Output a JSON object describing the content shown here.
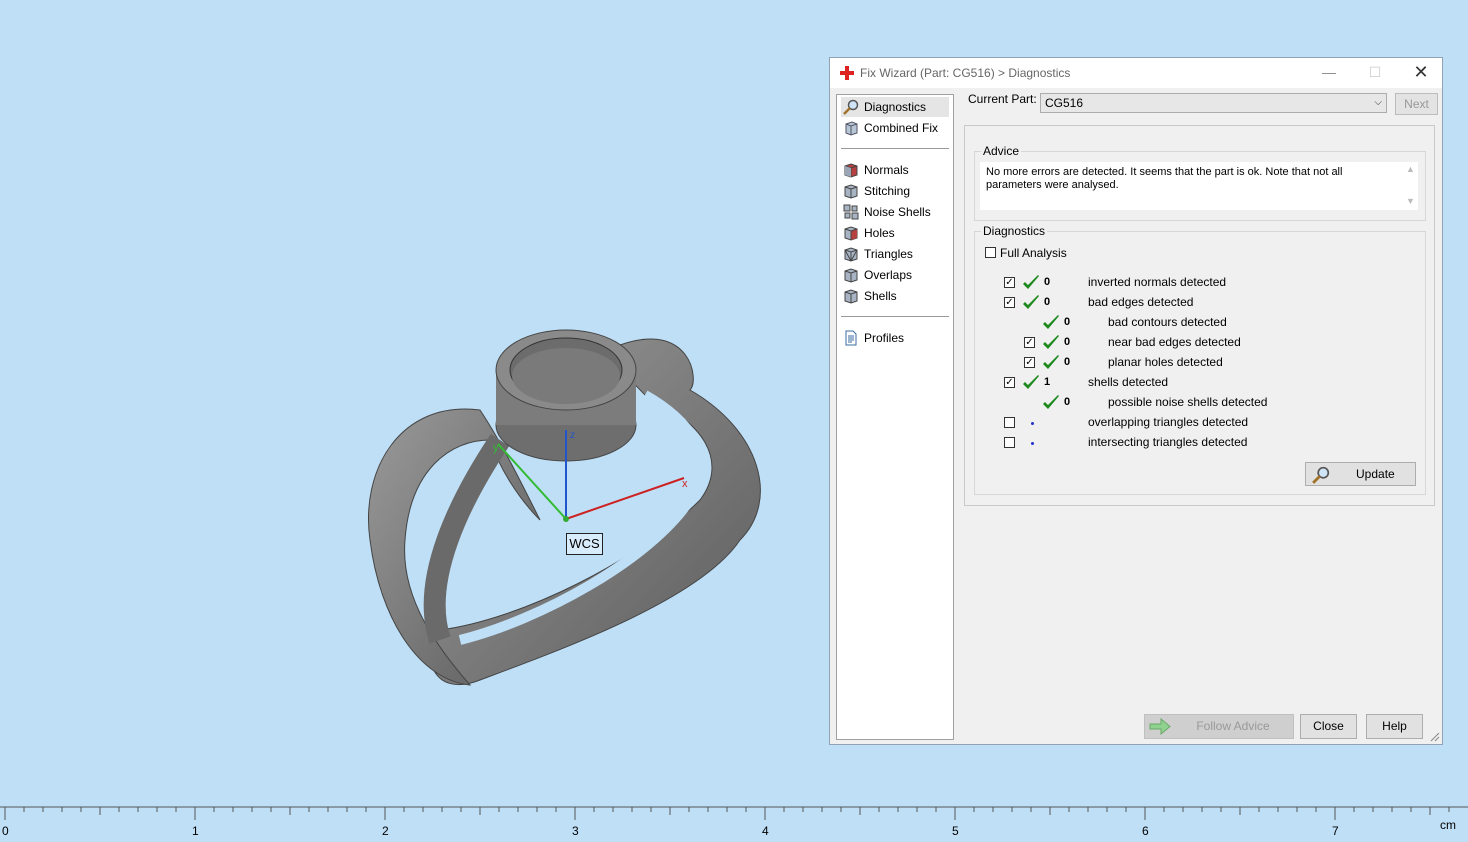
{
  "viewport": {
    "wcs_label": "WCS",
    "axes": {
      "x": "x",
      "y": "y",
      "z": "z"
    },
    "colors": {
      "background": "#bfdff6",
      "model": "#7a7a7a",
      "axis_x": "#cc2222",
      "axis_y": "#33bb33",
      "axis_z": "#2255cc"
    }
  },
  "ruler": {
    "labels": [
      "0",
      "1",
      "2",
      "3",
      "4",
      "5",
      "6",
      "7"
    ],
    "unit": "cm"
  },
  "dialog": {
    "title": "Fix Wizard (Part: CG516) > Diagnostics",
    "window_buttons": {
      "minimize": "—",
      "maximize": "☐",
      "close": "✕"
    },
    "sidebar": {
      "group1": [
        {
          "label": "Diagnostics",
          "icon": "magnifier-icon",
          "selected": true
        },
        {
          "label": "Combined Fix",
          "icon": "cube-icon"
        }
      ],
      "group2": [
        {
          "label": "Normals",
          "icon": "normals-cube-icon"
        },
        {
          "label": "Stitching",
          "icon": "stitching-cube-icon"
        },
        {
          "label": "Noise Shells",
          "icon": "noise-shells-icon"
        },
        {
          "label": "Holes",
          "icon": "holes-cube-icon"
        },
        {
          "label": "Triangles",
          "icon": "triangles-cube-icon"
        },
        {
          "label": "Overlaps",
          "icon": "overlaps-cube-icon"
        },
        {
          "label": "Shells",
          "icon": "shells-cube-icon"
        }
      ],
      "group3": [
        {
          "label": "Profiles",
          "icon": "document-icon"
        }
      ]
    },
    "current_part_label": "Current Part:",
    "current_part_value": "CG516",
    "next_label": "Next",
    "advice": {
      "title": "Advice",
      "text": "No more errors are detected. It seems that the part is ok. Note that not all parameters were analysed."
    },
    "diagnostics": {
      "title": "Diagnostics",
      "full_analysis": "Full Analysis",
      "rows": [
        {
          "checked": true,
          "status": "ok",
          "count": "0",
          "label": "inverted normals detected",
          "indent": 0
        },
        {
          "checked": true,
          "status": "ok",
          "count": "0",
          "label": "bad edges detected",
          "indent": 0
        },
        {
          "checked": null,
          "status": "ok",
          "count": "0",
          "label": "bad contours detected",
          "indent": 1
        },
        {
          "checked": true,
          "status": "ok",
          "count": "0",
          "label": "near bad edges detected",
          "indent": 1
        },
        {
          "checked": true,
          "status": "ok",
          "count": "0",
          "label": "planar holes detected",
          "indent": 1
        },
        {
          "checked": true,
          "status": "ok",
          "count": "1",
          "label": "shells detected",
          "indent": 0
        },
        {
          "checked": null,
          "status": "ok",
          "count": "0",
          "label": "possible noise shells detected",
          "indent": 1
        },
        {
          "checked": false,
          "status": "none",
          "count": "",
          "label": "overlapping triangles detected",
          "indent": 0
        },
        {
          "checked": false,
          "status": "none",
          "count": "",
          "label": "intersecting triangles detected",
          "indent": 0
        }
      ],
      "update_label": "Update"
    },
    "buttons": {
      "follow_advice": "Follow Advice",
      "close": "Close",
      "help": "Help"
    }
  }
}
